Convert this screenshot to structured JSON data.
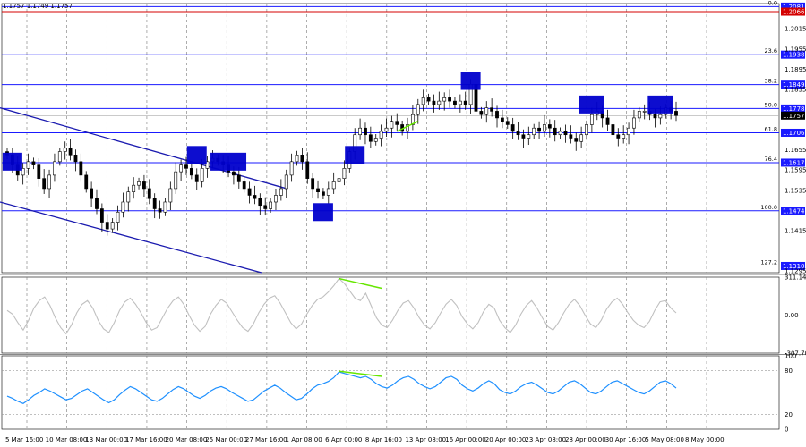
{
  "header": {
    "ohlc_text": "1.1757 1.1749 1.1757"
  },
  "chart_data": [
    {
      "type": "candlestick",
      "panel": "price",
      "ylim": [
        1.129,
        1.209
      ],
      "price_ticks": [
        "1.2015",
        "1.1955",
        "1.1895",
        "1.1835",
        "1.1655",
        "1.1595",
        "1.1535",
        "1.1415",
        "1.1295"
      ],
      "fib_levels": [
        {
          "label": "0.0",
          "value": 1.2081,
          "value_text": "1.2081"
        },
        {
          "label": "23.6",
          "value": 1.1938,
          "value_text": "1.1938"
        },
        {
          "label": "38.2",
          "value": 1.1849,
          "value_text": "1.1849"
        },
        {
          "label": "50.0",
          "value": 1.1778,
          "value_text": "1.1778"
        },
        {
          "label": "61.8",
          "value": 1.1706,
          "value_text": "1.1706"
        },
        {
          "label": "76.4",
          "value": 1.1617,
          "value_text": "1.1617"
        },
        {
          "label": "100.0",
          "value": 1.1474,
          "value_text": "1.1474"
        },
        {
          "label": "127.2",
          "value": 1.131,
          "value_text": "1.1310"
        }
      ],
      "red_level": {
        "value": 1.2066,
        "value_text": "1.2066"
      },
      "current_price": {
        "value": 1.1757,
        "value_text": "1.1757"
      },
      "close_series": [
        1.164,
        1.161,
        1.158,
        1.16,
        1.162,
        1.161,
        1.157,
        1.154,
        1.158,
        1.162,
        1.165,
        1.166,
        1.164,
        1.162,
        1.158,
        1.154,
        1.151,
        1.148,
        1.144,
        1.142,
        1.144,
        1.147,
        1.15,
        1.153,
        1.155,
        1.156,
        1.154,
        1.151,
        1.148,
        1.147,
        1.15,
        1.154,
        1.159,
        1.161,
        1.16,
        1.158,
        1.156,
        1.16,
        1.162,
        1.163,
        1.162,
        1.161,
        1.159,
        1.158,
        1.156,
        1.154,
        1.152,
        1.151,
        1.149,
        1.148,
        1.15,
        1.152,
        1.154,
        1.158,
        1.162,
        1.164,
        1.162,
        1.157,
        1.154,
        1.153,
        1.152,
        1.154,
        1.156,
        1.157,
        1.16,
        1.165,
        1.17,
        1.172,
        1.17,
        1.168,
        1.169,
        1.171,
        1.172,
        1.174,
        1.173,
        1.171,
        1.173,
        1.176,
        1.179,
        1.181,
        1.18,
        1.179,
        1.18,
        1.181,
        1.18,
        1.179,
        1.18,
        1.179,
        1.185,
        1.177,
        1.176,
        1.178,
        1.177,
        1.175,
        1.174,
        1.173,
        1.171,
        1.17,
        1.169,
        1.17,
        1.172,
        1.171,
        1.173,
        1.172,
        1.17,
        1.171,
        1.17,
        1.169,
        1.168,
        1.17,
        1.173,
        1.176,
        1.177,
        1.175,
        1.173,
        1.17,
        1.169,
        1.17,
        1.172,
        1.175,
        1.177,
        1.177,
        1.176,
        1.175,
        1.176,
        1.178,
        1.177,
        1.1757
      ],
      "annotations": [
        {
          "value": 1.162
        },
        {
          "value": 1.164
        },
        {
          "value": 1.162
        },
        {
          "value": 1.164
        },
        {
          "value": 1.147
        },
        {
          "value": 1.186
        },
        {
          "value": 1.179
        },
        {
          "value": 1.179
        }
      ],
      "channel_lines": true,
      "divergence_lines": true
    },
    {
      "type": "line",
      "panel": "cci",
      "ylim": [
        -307.704,
        311.1497
      ],
      "ticks": [
        "311.1497",
        "0.00",
        "-307.7040"
      ],
      "series": [
        {
          "values": [
            40,
            10,
            -60,
            -120,
            -40,
            60,
            120,
            150,
            80,
            -20,
            -100,
            -150,
            -80,
            20,
            90,
            120,
            60,
            -40,
            -110,
            -140,
            -60,
            40,
            110,
            140,
            90,
            20,
            -60,
            -120,
            -100,
            -20,
            60,
            120,
            150,
            90,
            0,
            -80,
            -130,
            -90,
            10,
            80,
            130,
            100,
            30,
            -40,
            -100,
            -130,
            -70,
            20,
            90,
            140,
            160,
            100,
            20,
            -60,
            -110,
            -70,
            10,
            80,
            130,
            150,
            190,
            240,
            300,
            260,
            200,
            140,
            120,
            180,
            80,
            -20,
            -80,
            -100,
            -40,
            40,
            100,
            120,
            60,
            -20,
            -80,
            -110,
            -60,
            20,
            90,
            130,
            80,
            -10,
            -70,
            -110,
            -60,
            30,
            90,
            60,
            -40,
            -100,
            -140,
            -80,
            10,
            80,
            120,
            60,
            -20,
            -90,
            -120,
            -60,
            20,
            90,
            130,
            80,
            0,
            -70,
            -100,
            -40,
            50,
            110,
            140,
            90,
            20,
            -40,
            -80,
            -100,
            -50,
            40,
            110,
            120,
            60,
            20
          ]
        }
      ]
    },
    {
      "type": "line",
      "panel": "rsi",
      "ylim": [
        0,
        100
      ],
      "ticks": [
        "100",
        "80",
        "20",
        "0"
      ],
      "series": [
        {
          "values": [
            45,
            42,
            38,
            35,
            40,
            46,
            50,
            55,
            52,
            48,
            44,
            40,
            42,
            47,
            52,
            55,
            50,
            45,
            40,
            36,
            40,
            47,
            53,
            58,
            55,
            50,
            45,
            40,
            38,
            42,
            48,
            54,
            58,
            55,
            50,
            45,
            42,
            46,
            52,
            56,
            58,
            55,
            50,
            46,
            42,
            38,
            40,
            46,
            52,
            56,
            60,
            56,
            50,
            45,
            40,
            42,
            48,
            55,
            60,
            62,
            65,
            70,
            78,
            76,
            74,
            72,
            70,
            72,
            68,
            62,
            58,
            56,
            60,
            66,
            70,
            72,
            68,
            62,
            58,
            55,
            58,
            64,
            70,
            72,
            68,
            60,
            55,
            52,
            56,
            62,
            66,
            62,
            54,
            50,
            48,
            52,
            58,
            62,
            64,
            60,
            55,
            50,
            48,
            52,
            58,
            64,
            66,
            62,
            56,
            50,
            48,
            52,
            58,
            64,
            66,
            62,
            58,
            54,
            50,
            48,
            52,
            58,
            64,
            66,
            62,
            56
          ]
        }
      ]
    }
  ],
  "time_labels": [
    "5 Mar 16:00",
    "10 Mar 08:00",
    "13 Mar 00:00",
    "17 Mar 16:00",
    "20 Mar 08:00",
    "25 Mar 00:00",
    "27 Mar 16:00",
    "1 Apr 08:00",
    "6 Apr 00:00",
    "8 Apr 16:00",
    "13 Apr 08:00",
    "16 Apr 00:00",
    "20 Apr 00:00",
    "23 Apr 08:00",
    "28 Apr 00:00",
    "30 Apr 16:00",
    "5 May 08:00",
    "8 May 00:00"
  ],
  "colors": {
    "candle": "#000000",
    "fib_line": "#1a1aff",
    "red_line": "#d40000",
    "box": "#0000cc",
    "channel": "#1a1aaf",
    "divergence": "#66e600",
    "cci_line": "#c0c0c0",
    "rsi_line": "#1e90ff",
    "grid": "#777777",
    "price_tag": "#000000"
  }
}
